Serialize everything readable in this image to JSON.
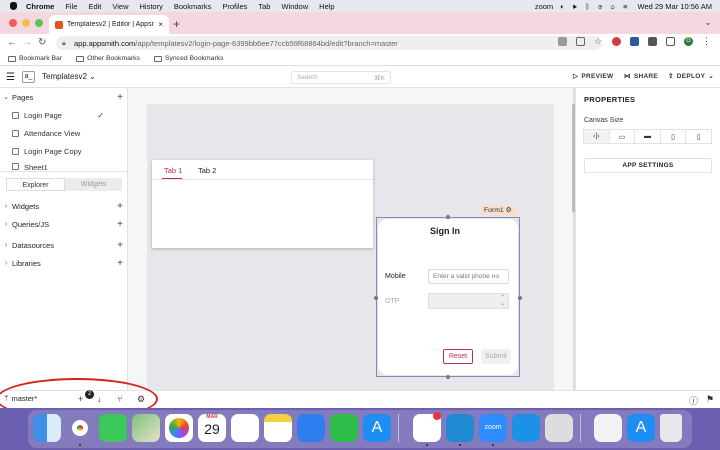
{
  "menubar": {
    "app": "Chrome",
    "items": [
      "File",
      "Edit",
      "View",
      "History",
      "Bookmarks",
      "Profiles",
      "Tab",
      "Window",
      "Help"
    ],
    "zoom_app": "zoom",
    "datetime": "Wed 29 Mar  10:56 AM"
  },
  "browser": {
    "tab_title": "Templatesv2 | Editor | Appsmith",
    "address_host": "app.appsmith.com",
    "address_path": "/app/templatesv2/login-page-6399bb6ee77ccb59f68864bd/edit?branch=master",
    "profile_letter": "G",
    "bookmarks": [
      "Bookmark Bar",
      "Other Bookmarks",
      "Synced Bookmarks"
    ]
  },
  "header": {
    "logo_text": "a_",
    "app_name": "Templatesv2",
    "search_placeholder": "Search",
    "search_shortcut": "⌘K",
    "preview": "PREVIEW",
    "share": "SHARE",
    "deploy": "DEPLOY"
  },
  "sidebar": {
    "pages_title": "Pages",
    "pages": [
      {
        "label": "Login Page",
        "selected": true
      },
      {
        "label": "Attendance View",
        "selected": false
      },
      {
        "label": "Login Page Copy",
        "selected": false
      },
      {
        "label": "Sheet1",
        "selected": false
      }
    ],
    "switch_explorer": "Explorer",
    "switch_widgets": "Widgets",
    "sections": [
      "Widgets",
      "Queries/JS",
      "Datasources",
      "Libraries"
    ]
  },
  "canvas": {
    "tabs_widget": {
      "tab1": "Tab 1",
      "tab2": "Tab 2"
    },
    "form": {
      "name_tag": "Form1",
      "title": "Sign In",
      "mobile_label": "Mobile",
      "mobile_placeholder": "Enter a valid phone no",
      "otp_label": "OTP",
      "reset_label": "Reset",
      "submit_label": "Submit"
    }
  },
  "properties": {
    "title": "PROPERTIES",
    "canvas_size_label": "Canvas Size",
    "app_settings": "APP SETTINGS"
  },
  "bottombar": {
    "branch": "master*",
    "pending_count": "2"
  },
  "dock": {
    "calendar_month": "MAR",
    "calendar_day": "29",
    "slack_badge": "1"
  },
  "colors": {
    "accent": "#c52e4b",
    "tabstrip": "#f5d7e1",
    "dock": "#6a5fb0",
    "annotation": "#d4231f"
  }
}
